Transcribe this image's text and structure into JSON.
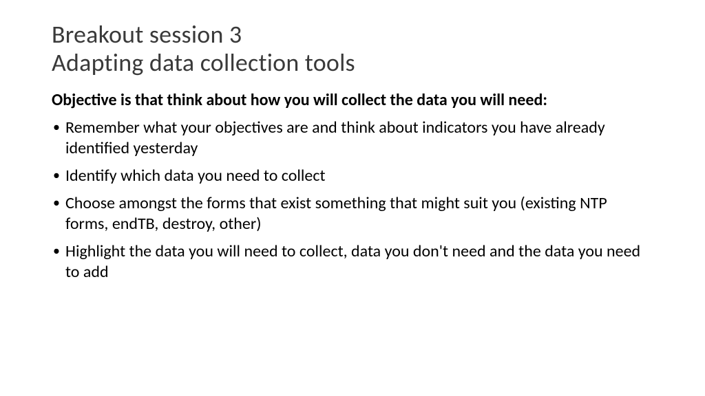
{
  "title": {
    "line1": "Breakout session 3",
    "line2": "Adapting data collection tools"
  },
  "objective": "Objective is that think about how you will collect the data you will need:",
  "bullets": [
    "Remember what your objectives are and think about indicators you have already identified yesterday",
    "Identify which data you need to collect",
    "Choose amongst the forms that exist something that might suit you (existing NTP forms, endTB, destroy, other)",
    "Highlight the data you will need to collect, data you don't need and the data you need to add"
  ]
}
